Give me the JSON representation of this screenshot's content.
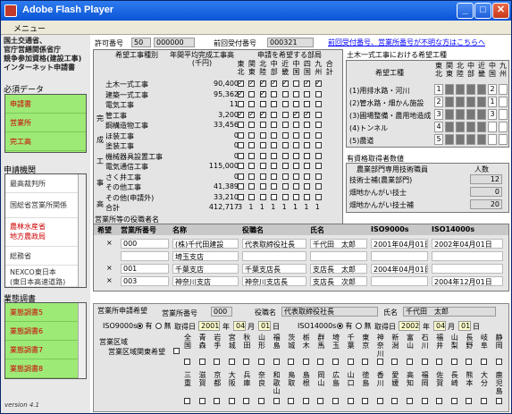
{
  "window": {
    "title": "Adobe Flash Player",
    "menu": "メニュー"
  },
  "left": {
    "logo_lines": [
      "国土交通省、",
      "官庁営繕関係省庁",
      "競争参加資格(建設工事)",
      "インターネット申請書"
    ],
    "section_required": "必須データ",
    "required_items": [
      "申請書",
      "営業所",
      "完工高"
    ],
    "section_agency": "申請機関",
    "agency_items": [
      "最高裁判所",
      "国総省営業所関係",
      "農林水産省\n地方農政局",
      "総務省",
      "NEXCO東日本\n(東日本高速道路)"
    ],
    "section_survey": "業態調書",
    "survey_items": [
      "業態調書5",
      "業態調書6",
      "業態調書7",
      "業態調書8"
    ],
    "version": "version 4.1"
  },
  "header": {
    "permit_label": "許可番号",
    "permit_pref": "50",
    "permit_no": "000000",
    "prev_label": "前回受付番号",
    "prev_no": "000321",
    "help_link": "前回受付番号、営業所番号が不明な方はこちらへ"
  },
  "works": {
    "col_type": "希望工事種別",
    "col_avg": "年間平均完成工事高\n(千円)",
    "col_regions": "申請を希望する部局",
    "region_heads": [
      "東北",
      "関東",
      "北陸",
      "中部",
      "近畿",
      "中国",
      "四国",
      "九州",
      "合計"
    ],
    "side_label": [
      "完",
      "成",
      "工",
      "事",
      "高"
    ],
    "rows": [
      {
        "name": "土木一式工事",
        "value": "90,400",
        "checks": [
          1,
          1,
          1,
          1,
          1,
          0,
          1,
          1
        ],
        "total": ""
      },
      {
        "name": "建築一式工事",
        "value": "95,362",
        "checks": [
          1,
          0,
          1,
          0,
          0,
          0,
          0,
          0
        ],
        "total": ""
      },
      {
        "name": "電気工事",
        "value": "11",
        "checks": [
          0,
          0,
          0,
          0,
          0,
          0,
          0,
          0
        ],
        "total": ""
      },
      {
        "name": "管工事",
        "value": "3,200",
        "checks": [
          1,
          1,
          1,
          0,
          0,
          1,
          1,
          0
        ],
        "total": ""
      },
      {
        "name": "鋼構造物工事",
        "value": "33,456",
        "checks": [
          0,
          0,
          0,
          0,
          0,
          0,
          0,
          0
        ],
        "total": ""
      },
      {
        "name": "ほ装工事",
        "value": "0",
        "checks": [
          0,
          0,
          0,
          0,
          0,
          0,
          0,
          0
        ],
        "total": ""
      },
      {
        "name": "塗装工事",
        "value": "0",
        "checks": [
          0,
          0,
          0,
          0,
          0,
          0,
          0,
          0
        ],
        "total": ""
      },
      {
        "name": "機械器具設置工事",
        "value": "0",
        "checks": [
          0,
          0,
          0,
          0,
          0,
          0,
          0,
          0
        ],
        "total": ""
      },
      {
        "name": "電気通信工事",
        "value": "115,000",
        "checks": [
          0,
          0,
          0,
          0,
          0,
          0,
          0,
          0
        ],
        "total": ""
      },
      {
        "name": "さく井工事",
        "value": "0",
        "checks": [
          0,
          0,
          0,
          0,
          0,
          0,
          0,
          0
        ],
        "total": ""
      },
      {
        "name": "その他工事",
        "value": "41,389",
        "checks": [
          0,
          0,
          0,
          0,
          0,
          0,
          0,
          0
        ],
        "total": ""
      },
      {
        "name": "その他(申請外)",
        "value": "33,210",
        "checks": [
          0,
          0,
          0,
          0,
          0,
          0,
          0,
          0
        ],
        "total": ""
      },
      {
        "name": "合計",
        "value": "412,717",
        "checks": [],
        "totals": [
          "3",
          "1",
          "1",
          "1",
          "1",
          "1",
          "1",
          "1"
        ]
      }
    ]
  },
  "civil": {
    "title": "土木一式工事における希望工種",
    "col_type": "希望工種",
    "region_heads": [
      "東北",
      "関東",
      "北陸",
      "中部",
      "近畿",
      "中国",
      "九州"
    ],
    "rows": [
      {
        "name": "(1)用排水路・河川",
        "marks": [
          "1",
          "",
          "",
          "",
          "",
          "2",
          ""
        ]
      },
      {
        "name": "(2)管水路・畑かん施設",
        "marks": [
          "2",
          "",
          "",
          "",
          "",
          "1",
          ""
        ]
      },
      {
        "name": "(3)圃場整備・農用地造成",
        "marks": [
          "3",
          "",
          "",
          "",
          "",
          "3",
          ""
        ]
      },
      {
        "name": "(4)トンネル",
        "marks": [
          "4",
          "",
          "",
          "",
          "",
          "",
          ""
        ]
      },
      {
        "name": "(5)農道",
        "marks": [
          "5",
          "",
          "",
          "",
          "",
          "",
          ""
        ]
      }
    ]
  },
  "qualified": {
    "title": "有資格取得者数値",
    "col_a": "農業部門専用技術職員",
    "col_b": "人数",
    "rows": [
      {
        "name": "技術士補(農業部門)",
        "count": "12"
      },
      {
        "name": "畑地かんがい技士",
        "count": "0"
      },
      {
        "name": "畑地かんがい技士補",
        "count": "20"
      }
    ]
  },
  "offices": {
    "title": "営業所等の役職者名",
    "headers": [
      "希望",
      "営業所番号",
      "名称",
      "役職名",
      "氏名",
      "ISO9000s",
      "ISO14000s"
    ],
    "rows": [
      {
        "mark": "×",
        "no": "000",
        "name": "(株)千代田建設",
        "role": "代表取締役社長",
        "person": "千代田　太郎",
        "iso9": "2001年04月01日",
        "iso14": "2002年04月01日"
      },
      {
        "mark": "",
        "no": "",
        "name": "埼玉支店",
        "role": "",
        "person": "",
        "iso9": "",
        "iso14": ""
      },
      {
        "mark": "×",
        "no": "001",
        "name": "千葉支店",
        "role": "千葉支店長",
        "person": "支店長　太郎",
        "iso9": "2004年04月01日",
        "iso14": ""
      },
      {
        "mark": "×",
        "no": "003",
        "name": "神奈川支店",
        "role": "神奈川支店長",
        "person": "支店長　次郎",
        "iso9": "",
        "iso14": "2004年12月01日"
      }
    ]
  },
  "applicant": {
    "office_label": "営業所申請希望",
    "office_no_label": "営業所番号",
    "office_no": "000",
    "role_label": "役職名",
    "role": "代表取締役社長",
    "name_label": "氏名",
    "name": "千代田　太郎",
    "iso9_label": "ISO9000s",
    "iso14_label": "ISO14000s",
    "yes": "有",
    "no": "無",
    "acq": "取得日",
    "iso9_year": "2001",
    "iso9_month": "04",
    "iso9_day": "01",
    "iso14_year": "2002",
    "iso14_month": "04",
    "iso14_day": "01",
    "y": "年",
    "m": "月",
    "d": "日",
    "area_label": "営業区域",
    "area_dont_care": "営業区域関東希望",
    "prefs_top": [
      "全国",
      "青森",
      "岩手",
      "宮城",
      "秋田",
      "山形",
      "福島",
      "茨城",
      "栃木",
      "群馬",
      "埼玉",
      "千葉",
      "東京",
      "神奈川",
      "新潟",
      "富山",
      "石川",
      "福井",
      "山梨",
      "長野",
      "岐阜",
      "静岡"
    ],
    "prefs_bottom": [
      "三重",
      "滋賀",
      "京都",
      "大阪",
      "兵庫",
      "奈良",
      "和歌山",
      "鳥取",
      "島根",
      "岡山",
      "広島",
      "山口",
      "徳島",
      "香川",
      "愛媛",
      "高知",
      "福岡",
      "佐賀",
      "長崎",
      "熊本",
      "大分",
      "鹿児島"
    ]
  }
}
